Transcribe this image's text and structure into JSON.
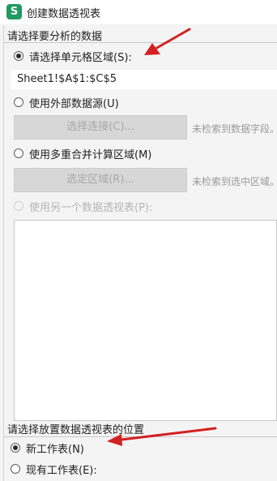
{
  "window": {
    "title": "创建数据透视表",
    "icon_letter": "S"
  },
  "source_group": {
    "label": "请选择要分析的数据",
    "options": [
      {
        "label": "请选择单元格区域(S):",
        "checked": true,
        "disabled": false
      },
      {
        "label": "使用外部数据源(U)",
        "checked": false,
        "disabled": false
      },
      {
        "label": "使用多重合并计算区域(M)",
        "checked": false,
        "disabled": false
      },
      {
        "label": "使用另一个数据透视表(P):",
        "checked": false,
        "disabled": true
      }
    ],
    "range_value": "Sheet1!$A$1:$C$5",
    "select_connection_button": "选择连接(C)...",
    "no_fields_hint": "未检索到数据字段。",
    "select_region_button": "选定区域(R)...",
    "no_region_hint": "未检索到选中区域。"
  },
  "placement_group": {
    "label": "请选择放置数据透视表的位置",
    "options": [
      {
        "label": "新工作表(N)",
        "checked": true
      },
      {
        "label": "现有工作表(E):",
        "checked": false
      }
    ]
  },
  "colors": {
    "annotation_arrow": "#d42020",
    "app_icon": "#1f9b63"
  }
}
